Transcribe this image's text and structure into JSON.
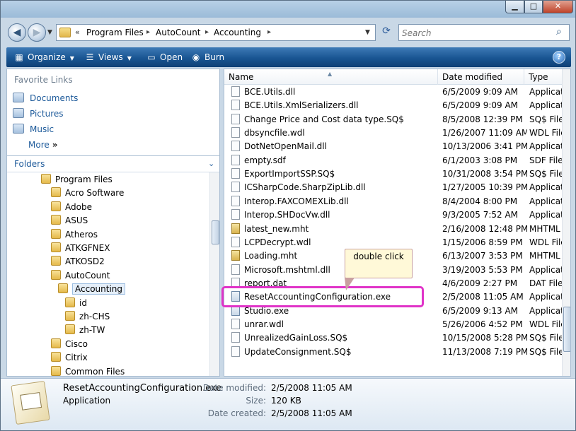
{
  "window": {
    "min_symbol": "▁",
    "max_symbol": "□",
    "close_symbol": "✕"
  },
  "nav": {
    "back_symbol": "◀",
    "forward_symbol": "▶",
    "dropdown_symbol": "▼"
  },
  "address": {
    "chevron": "«",
    "crumbs": [
      "Program Files",
      "AutoCount",
      "Accounting"
    ],
    "separator": "▸",
    "dropdown_symbol": "▼",
    "refresh_symbol": "⟳"
  },
  "search": {
    "placeholder": "Search",
    "icon": "⌕"
  },
  "toolbar": {
    "organize": "Organize",
    "views": "Views",
    "open": "Open",
    "burn": "Burn",
    "caret": "▼",
    "help": "?"
  },
  "navpane": {
    "favorite_title": "Favorite Links",
    "favorites": [
      "Documents",
      "Pictures",
      "Music"
    ],
    "more": "More",
    "more_symbol": "»",
    "folders_label": "Folders",
    "folders_chevron": "⌄",
    "tree": [
      {
        "label": "Program Files",
        "level": 0
      },
      {
        "label": "Acro Software",
        "level": 1
      },
      {
        "label": "Adobe",
        "level": 1
      },
      {
        "label": "ASUS",
        "level": 1
      },
      {
        "label": "Atheros",
        "level": 1
      },
      {
        "label": "ATKGFNEX",
        "level": 1
      },
      {
        "label": "ATKOSD2",
        "level": 1
      },
      {
        "label": "AutoCount",
        "level": 1
      },
      {
        "label": "Accounting",
        "level": 2,
        "selected": true
      },
      {
        "label": "id",
        "level": 3
      },
      {
        "label": "zh-CHS",
        "level": 3
      },
      {
        "label": "zh-TW",
        "level": 3
      },
      {
        "label": "Cisco",
        "level": 1
      },
      {
        "label": "Citrix",
        "level": 1
      },
      {
        "label": "Common Files",
        "level": 1
      }
    ]
  },
  "filelist": {
    "columns": {
      "name": "Name",
      "date": "Date modified",
      "type": "Type"
    },
    "sort_symbol": "▲",
    "rows": [
      {
        "name": "BCE.Utils.dll",
        "date": "6/5/2009 9:09 AM",
        "type": "Applicat",
        "icon": "dll"
      },
      {
        "name": "BCE.Utils.XmlSerializers.dll",
        "date": "6/5/2009 9:09 AM",
        "type": "Applicat",
        "icon": "dll"
      },
      {
        "name": "Change Price and Cost data type.SQ$",
        "date": "8/5/2008 12:39 PM",
        "type": "SQ$ File",
        "icon": "file"
      },
      {
        "name": "dbsyncfile.wdl",
        "date": "1/26/2007 11:09 AM",
        "type": "WDL File",
        "icon": "file"
      },
      {
        "name": "DotNetOpenMail.dll",
        "date": "10/13/2006 3:41 PM",
        "type": "Applicat",
        "icon": "dll"
      },
      {
        "name": "empty.sdf",
        "date": "6/1/2003 3:08 PM",
        "type": "SDF File",
        "icon": "file"
      },
      {
        "name": "ExportImportSSP.SQ$",
        "date": "10/31/2008 3:54 PM",
        "type": "SQ$ File",
        "icon": "file"
      },
      {
        "name": "ICSharpCode.SharpZipLib.dll",
        "date": "1/27/2005 10:39 PM",
        "type": "Applicat",
        "icon": "dll"
      },
      {
        "name": "Interop.FAXCOMEXLib.dll",
        "date": "8/4/2004 8:00 PM",
        "type": "Applicat",
        "icon": "dll"
      },
      {
        "name": "Interop.SHDocVw.dll",
        "date": "9/3/2005 7:52 AM",
        "type": "Applicat",
        "icon": "dll"
      },
      {
        "name": "latest_new.mht",
        "date": "2/16/2008 12:48 PM",
        "type": "MHTML",
        "icon": "mht"
      },
      {
        "name": "LCPDecrypt.wdl",
        "date": "1/15/2006 8:59 PM",
        "type": "WDL File",
        "icon": "file"
      },
      {
        "name": "Loading.mht",
        "date": "6/13/2007 3:53 PM",
        "type": "MHTML",
        "icon": "mht"
      },
      {
        "name": "Microsoft.mshtml.dll",
        "date": "3/19/2003 5:53 PM",
        "type": "Applicat",
        "icon": "dll"
      },
      {
        "name": "report.dat",
        "date": "4/6/2009 2:27 PM",
        "type": "DAT File",
        "icon": "file"
      },
      {
        "name": "ResetAccountingConfiguration.exe",
        "date": "2/5/2008 11:05 AM",
        "type": "Applicat",
        "icon": "exe"
      },
      {
        "name": "Studio.exe",
        "date": "6/5/2009 9:13 AM",
        "type": "Applicat",
        "icon": "exe"
      },
      {
        "name": "unrar.wdl",
        "date": "5/26/2006 4:52 PM",
        "type": "WDL File",
        "icon": "file"
      },
      {
        "name": "UnrealizedGainLoss.SQ$",
        "date": "10/15/2008 5:28 PM",
        "type": "SQ$ File",
        "icon": "file"
      },
      {
        "name": "UpdateConsignment.SQ$",
        "date": "11/13/2008 7:19 PM",
        "type": "SQ$ File",
        "icon": "file"
      }
    ]
  },
  "annotation": {
    "callout_text": "double click"
  },
  "details": {
    "name": "ResetAccountingConfiguration.exe",
    "type": "Application",
    "date_modified_label": "Date modified:",
    "date_modified": "2/5/2008 11:05 AM",
    "size_label": "Size:",
    "size": "120 KB",
    "date_created_label": "Date created:",
    "date_created": "2/5/2008 11:05 AM"
  }
}
